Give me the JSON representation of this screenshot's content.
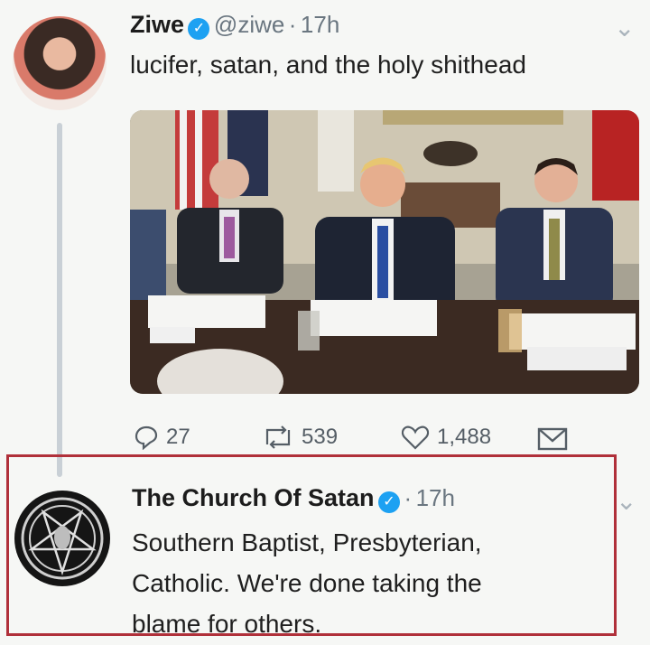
{
  "tweet1": {
    "name": "Ziwe",
    "handle": "@ziwe",
    "sep": "·",
    "time": "17h",
    "text": "lucifer, satan, and the holy shithead",
    "actions": {
      "replies": "27",
      "retweets": "539",
      "likes": "1,488"
    }
  },
  "tweet2": {
    "name": "The Church Of Satan",
    "sep": "·",
    "time": "17h",
    "text_lines": [
      "Southern Baptist, Presbyterian,",
      "Catholic. We're done taking the",
      "blame for others."
    ]
  },
  "colors": {
    "verified": "#1da1f2",
    "highlight": "#b0303a",
    "thread_line": "#c9d0d6"
  },
  "icons": [
    "verified-icon",
    "reply-icon",
    "retweet-icon",
    "like-icon",
    "dm-icon",
    "chevron-down-icon",
    "pentagram-icon"
  ]
}
